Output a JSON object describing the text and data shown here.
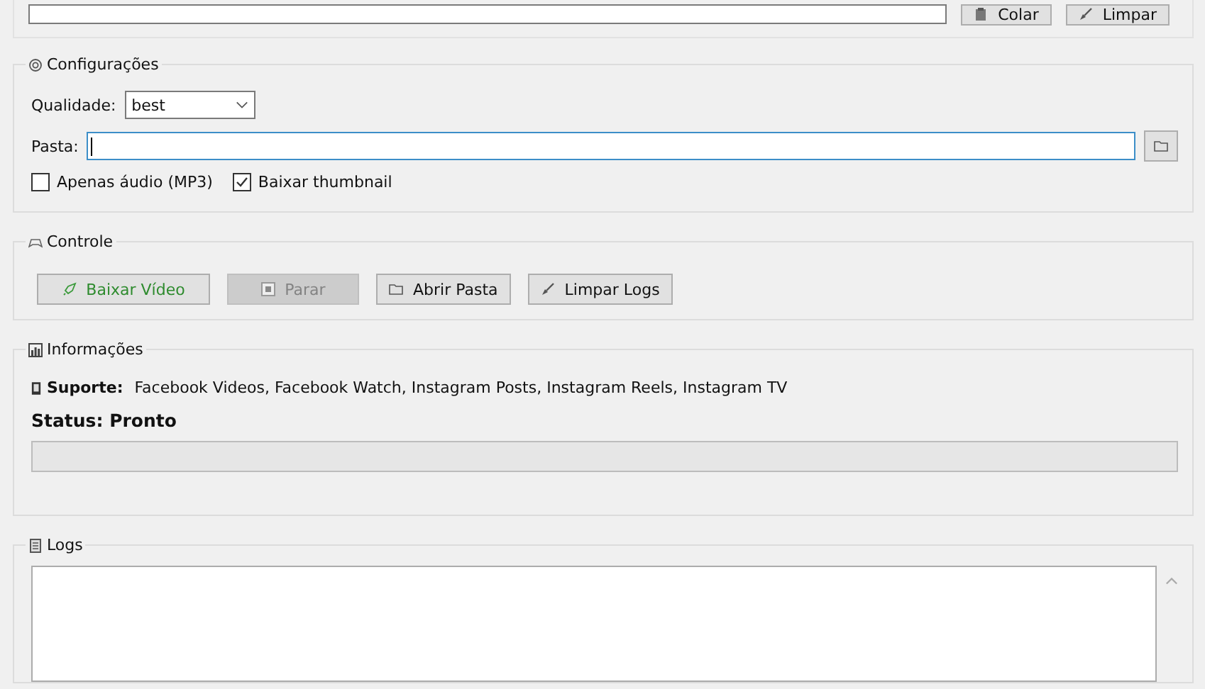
{
  "top_buttons": [
    {
      "label": "Colar",
      "kind": "paste"
    },
    {
      "label": "Limpar",
      "kind": "clear"
    }
  ],
  "settings": {
    "title": "Configurações",
    "quality_label": "Qualidade:",
    "quality_value": "best",
    "folder_label": "Pasta:",
    "folder_focused": true,
    "checkboxes": [
      {
        "label": "Apenas áudio (MP3)",
        "checked": false
      },
      {
        "label": "Baixar thumbnail",
        "checked": true
      }
    ]
  },
  "control": {
    "title": "Controle",
    "buttons": [
      {
        "label": "Baixar Vídeo",
        "kind": "download",
        "disabled": false
      },
      {
        "label": "Parar",
        "kind": "stop",
        "disabled": true
      },
      {
        "label": "Abrir Pasta",
        "kind": "folder",
        "disabled": false
      },
      {
        "label": "Limpar Logs",
        "kind": "clear",
        "disabled": false
      }
    ]
  },
  "info": {
    "title": "Informações",
    "support_label": "Suporte:",
    "support_value": "Facebook Videos, Facebook Watch, Instagram Posts, Instagram Reels, Instagram TV",
    "status": "Status: Pronto",
    "level": 0
  },
  "logs": {
    "title": "Logs"
  }
}
